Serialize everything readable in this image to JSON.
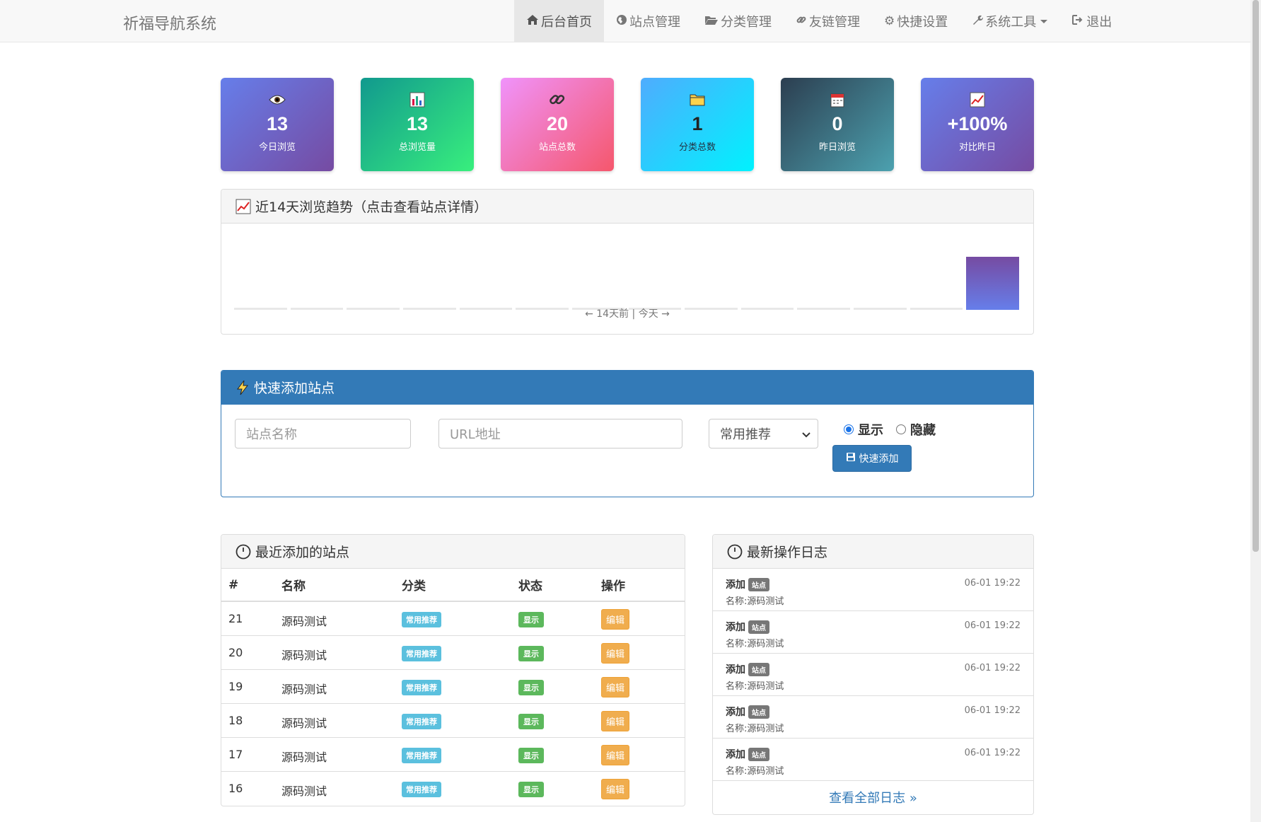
{
  "brand": "祈福导航系统",
  "nav": [
    {
      "label": "后台首页",
      "icon": "home-icon",
      "active": true
    },
    {
      "label": "站点管理",
      "icon": "globe-icon",
      "active": false
    },
    {
      "label": "分类管理",
      "icon": "folder-open-icon",
      "active": false
    },
    {
      "label": "友链管理",
      "icon": "link-icon",
      "active": false
    },
    {
      "label": "快捷设置",
      "icon": "gear-icon",
      "active": false
    },
    {
      "label": "系统工具",
      "icon": "wrench-icon",
      "active": false,
      "dropdown": true
    },
    {
      "label": "退出",
      "icon": "logout-icon",
      "active": false
    }
  ],
  "stats": [
    {
      "value": "13",
      "label": "今日浏览",
      "icon": "eye-icon",
      "gradient": [
        "#667eea",
        "#764ba2"
      ]
    },
    {
      "value": "13",
      "label": "总浏览量",
      "icon": "bar-chart-icon",
      "gradient": [
        "#11998e",
        "#38ef7d"
      ]
    },
    {
      "value": "20",
      "label": "站点总数",
      "icon": "link-icon",
      "gradient": [
        "#f093fb",
        "#f5576c"
      ]
    },
    {
      "value": "1",
      "label": "分类总数",
      "icon": "folder-icon",
      "gradient": [
        "#4facfe",
        "#00f2fe"
      ]
    },
    {
      "value": "0",
      "label": "昨日浏览",
      "icon": "calendar-icon",
      "gradient": [
        "#2c3e50",
        "#4ca1af"
      ]
    },
    {
      "value": "+100%",
      "label": "对比昨日",
      "icon": "trend-icon",
      "gradient": [
        "#667eea",
        "#764ba2"
      ]
    }
  ],
  "trend": {
    "title": "近14天浏览趋势（点击查看站点详情）",
    "caption": "← 14天前 | 今天 →"
  },
  "chart_data": {
    "type": "bar",
    "title": "近14天浏览趋势（点击查看站点详情）",
    "categories": [
      "",
      "",
      "",
      "",
      "",
      "",
      "",
      "",
      "",
      "",
      "",
      "",
      "",
      ""
    ],
    "values": [
      0,
      0,
      0,
      0,
      0,
      0,
      0,
      0,
      0,
      0,
      0,
      0,
      0,
      13
    ],
    "xlabel": "← 14天前 | 今天 →",
    "ylabel": "",
    "grid": false
  },
  "quick_add": {
    "title": "快速添加站点",
    "name_placeholder": "站点名称",
    "url_placeholder": "URL地址",
    "category_selected": "常用推荐",
    "radio_show": "显示",
    "radio_hide": "隐藏",
    "submit_label": "快速添加"
  },
  "recent_sites": {
    "title": "最近添加的站点",
    "columns": [
      "#",
      "名称",
      "分类",
      "状态",
      "操作"
    ],
    "rows": [
      {
        "id": "21",
        "name": "源码测试",
        "category": "常用推荐",
        "status": "显示",
        "action": "编辑"
      },
      {
        "id": "20",
        "name": "源码测试",
        "category": "常用推荐",
        "status": "显示",
        "action": "编辑"
      },
      {
        "id": "19",
        "name": "源码测试",
        "category": "常用推荐",
        "status": "显示",
        "action": "编辑"
      },
      {
        "id": "18",
        "name": "源码测试",
        "category": "常用推荐",
        "status": "显示",
        "action": "编辑"
      },
      {
        "id": "17",
        "name": "源码测试",
        "category": "常用推荐",
        "status": "显示",
        "action": "编辑"
      },
      {
        "id": "16",
        "name": "源码测试",
        "category": "常用推荐",
        "status": "显示",
        "action": "编辑"
      }
    ]
  },
  "logs": {
    "title": "最新操作日志",
    "items": [
      {
        "action": "添加",
        "tag": "站点",
        "desc": "名称:源码测试",
        "time": "06-01 19:22"
      },
      {
        "action": "添加",
        "tag": "站点",
        "desc": "名称:源码测试",
        "time": "06-01 19:22"
      },
      {
        "action": "添加",
        "tag": "站点",
        "desc": "名称:源码测试",
        "time": "06-01 19:22"
      },
      {
        "action": "添加",
        "tag": "站点",
        "desc": "名称:源码测试",
        "time": "06-01 19:22"
      },
      {
        "action": "添加",
        "tag": "站点",
        "desc": "名称:源码测试",
        "time": "06-01 19:22"
      }
    ],
    "more_label": "查看全部日志 »"
  }
}
